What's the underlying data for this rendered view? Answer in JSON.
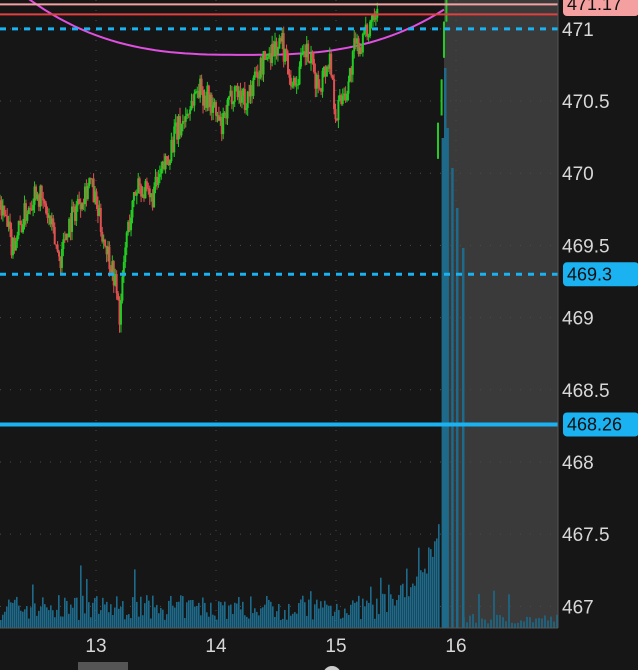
{
  "chart_data": {
    "type": "candlestick",
    "y_ticks": [
      467,
      467.5,
      468,
      468.5,
      469,
      469.5,
      470,
      470.5,
      471
    ],
    "y_tick_labels": [
      "467",
      "467.5",
      "468",
      "468.5",
      "469",
      "469.5",
      "470",
      "470.5",
      "471"
    ],
    "ylim": [
      466.85,
      471.2
    ],
    "x_ticks": [
      13,
      14,
      15,
      16
    ],
    "x_tick_labels": [
      "13",
      "14",
      "15",
      "16"
    ],
    "xlim": [
      12.2,
      16.85
    ],
    "expansion_area_start": 15.9,
    "grid": true,
    "price_levels": [
      {
        "label": "471.17",
        "value": 471.17,
        "color": "#f4a0a0",
        "style": "solid"
      },
      {
        "label": "471.1",
        "value": 471.1,
        "color": "#e04040",
        "style": "solid"
      },
      {
        "label": "",
        "value": 471.0,
        "color": "#1ab2f0",
        "style": "dashed"
      },
      {
        "label": "469.3",
        "value": 469.3,
        "color": "#1ab2f0",
        "style": "dashed"
      },
      {
        "label": "468.26",
        "value": 468.26,
        "color": "#1ab2f0",
        "style": "solid"
      }
    ],
    "colors": {
      "up": "#22cc22",
      "down": "#e05050",
      "volume": "#1d6a8a",
      "curve": "#e050e0"
    },
    "series": [
      {
        "name": "price",
        "anchors_t": [
          12.2,
          12.3,
          12.4,
          12.5,
          12.6,
          12.7,
          12.75,
          12.85,
          12.95,
          13.05,
          13.15,
          13.2,
          13.25,
          13.35,
          13.45,
          13.55,
          13.65,
          13.75,
          13.85,
          13.95,
          14.05,
          14.15,
          14.25,
          14.35,
          14.45,
          14.55,
          14.65,
          14.75,
          14.85,
          14.95,
          15.0,
          15.05,
          15.1,
          15.15,
          15.25,
          15.3,
          15.35
        ],
        "anchors_v": [
          469.8,
          469.5,
          469.7,
          469.9,
          469.7,
          469.4,
          469.6,
          469.8,
          469.95,
          469.6,
          469.3,
          469.0,
          469.55,
          469.95,
          469.8,
          470.0,
          470.25,
          470.4,
          470.6,
          470.5,
          470.3,
          470.6,
          470.5,
          470.7,
          470.85,
          470.9,
          470.6,
          470.85,
          470.6,
          470.8,
          470.4,
          470.55,
          470.6,
          470.85,
          470.95,
          471.1,
          471.2
        ]
      },
      {
        "name": "spike",
        "anchors_t": [
          15.85,
          15.88,
          15.9,
          15.92,
          15.94
        ],
        "anchors_v": [
          470.3,
          470.6,
          471.0,
          471.25,
          471.4
        ]
      }
    ]
  }
}
